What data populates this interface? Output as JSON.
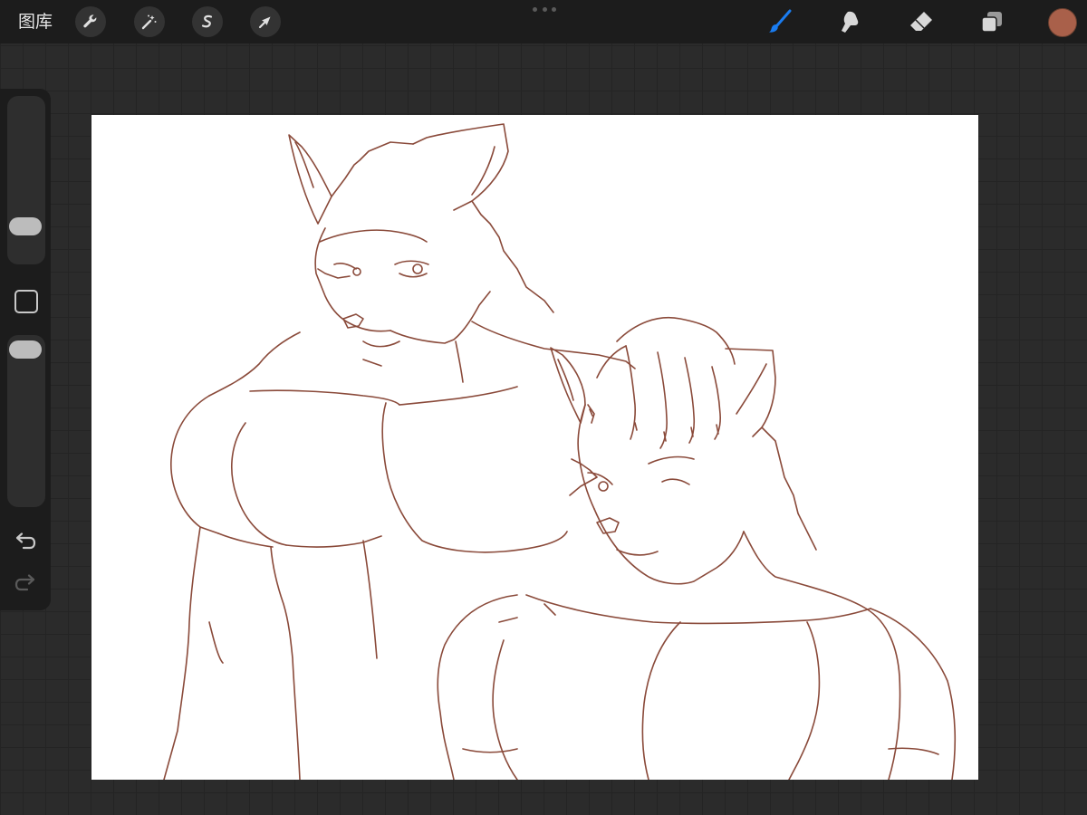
{
  "topbar": {
    "gallery_label": "图库",
    "tools": [
      {
        "name": "actions",
        "icon": "wrench-icon"
      },
      {
        "name": "adjustments",
        "icon": "magic-wand-icon"
      },
      {
        "name": "selection",
        "icon": "selection-icon"
      },
      {
        "name": "transform",
        "icon": "arrow-cursor-icon"
      }
    ],
    "right_tools": [
      {
        "name": "brush",
        "icon": "brush-icon",
        "active": true
      },
      {
        "name": "smudge",
        "icon": "smudge-icon"
      },
      {
        "name": "eraser",
        "icon": "eraser-icon"
      },
      {
        "name": "layers",
        "icon": "layers-icon"
      }
    ],
    "current_color": "#a9604a"
  },
  "sidebar": {
    "brush_size_slider": "slider",
    "modify_button": "square-icon",
    "opacity_slider": "slider",
    "undo": "undo-icon",
    "redo": "redo-icon"
  },
  "colors": {
    "accent_active": "#1a7cf0",
    "line_art": "#8a4a3a",
    "toolbar_bg": "#1c1c1c"
  }
}
